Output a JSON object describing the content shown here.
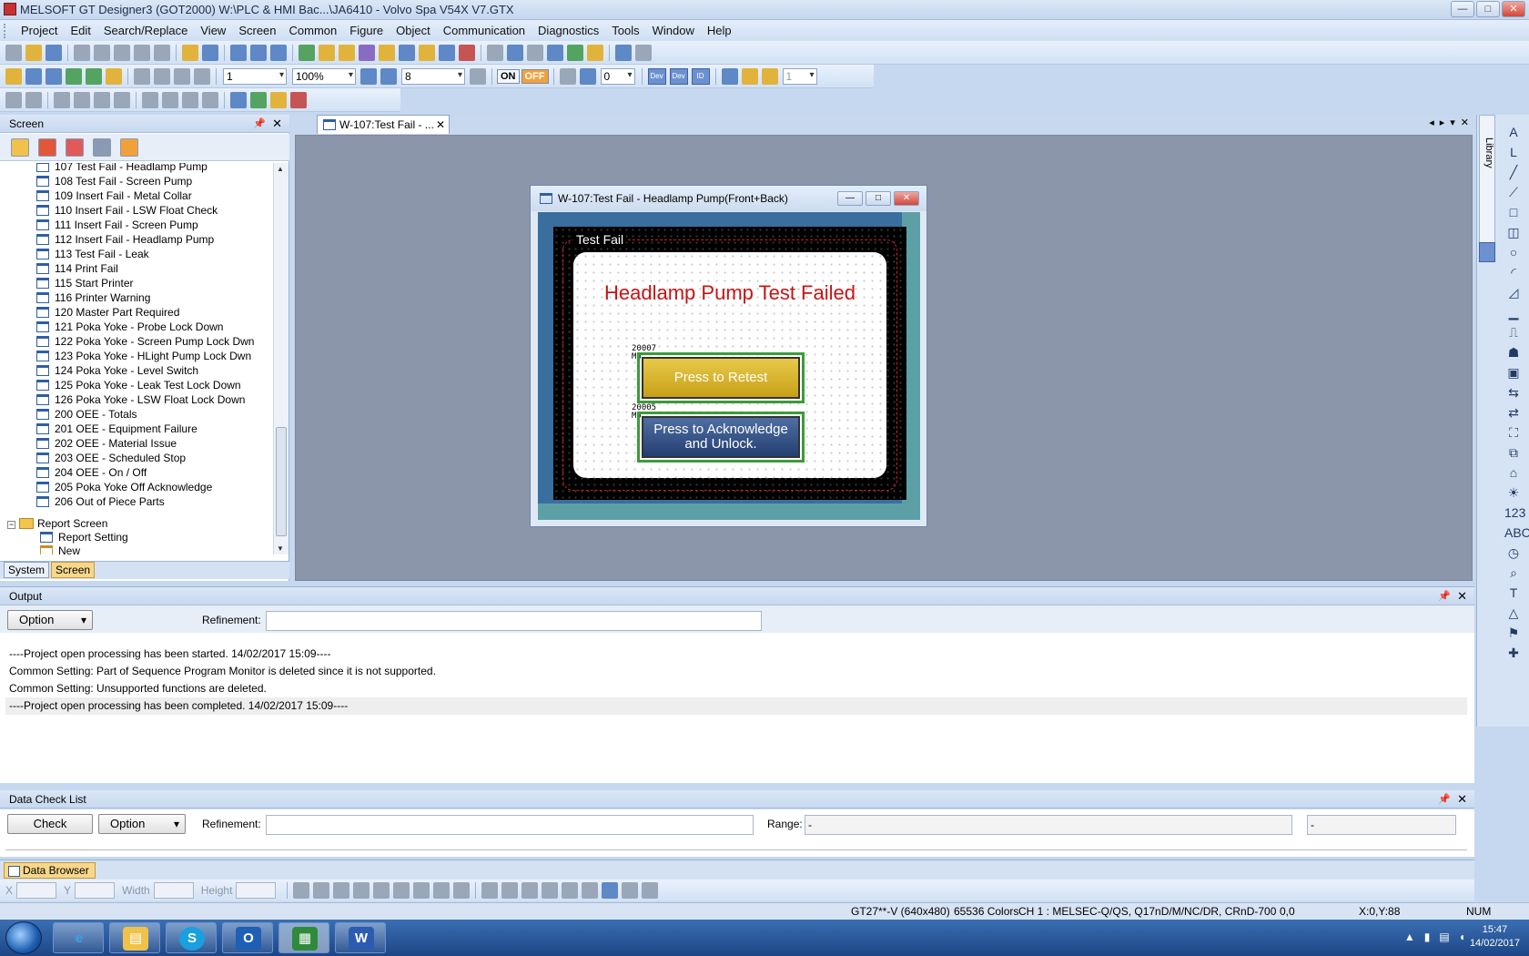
{
  "window": {
    "title": "MELSOFT GT Designer3 (GOT2000) W:\\PLC & HMI Bac...\\JA6410 - Volvo Spa V54X V7.GTX",
    "btn_minimize": "—",
    "btn_maximize": "□",
    "btn_close": "✕"
  },
  "menu": [
    "Project",
    "Edit",
    "Search/Replace",
    "View",
    "Screen",
    "Common",
    "Figure",
    "Object",
    "Communication",
    "Diagnostics",
    "Tools",
    "Window",
    "Help"
  ],
  "toolbar": {
    "screen_no": "1",
    "zoom": "100%",
    "grid": "8",
    "on_label": "ON",
    "off_label": "OFF",
    "nav_value": "0",
    "layer_value": "1",
    "dev_label": "Dev",
    "id_label": "ID"
  },
  "screen_panel": {
    "title": "Screen",
    "pin": "📌",
    "close": "✕",
    "items": [
      "107 Test Fail - Headlamp Pump",
      "108 Test Fail - Screen Pump",
      "109 Insert Fail - Metal Collar",
      "110 Insert Fail - LSW Float Check",
      "111 Insert Fail - Screen Pump",
      "112 Insert Fail - Headlamp Pump",
      "113 Test Fail - Leak",
      "114 Print Fail",
      "115 Start Printer",
      "116 Printer Warning",
      "120 Master Part Required",
      "121 Poka Yoke - Probe Lock Down",
      "122 Poka Yoke - Screen Pump Lock Dwn",
      "123 Poka Yoke - HLight Pump Lock Dwn",
      "124 Poka Yoke - Level Switch",
      "125 Poka Yoke - Leak Test Lock Down",
      "126 Poka Yoke - LSW Float Lock Down",
      "200 OEE - Totals",
      "201 OEE - Equipment Failure",
      "202 OEE - Material Issue",
      "203 OEE - Scheduled Stop",
      "204 OEE - On / Off",
      "205 Poka Yoke Off Acknowledge",
      "206 Out of Piece Parts"
    ],
    "folder": "Report Screen",
    "folder_items": [
      "Report Setting",
      "New"
    ],
    "tabs": [
      "System",
      "Screen"
    ]
  },
  "document": {
    "tab_label": "W-107:Test Fail - ...",
    "tab_close": "✕",
    "child_title": "W-107:Test Fail - Headlamp Pump(Front+Back)",
    "frame_label": "Test Fail",
    "heading": "Headlamp Pump Test Failed",
    "retest_device": "20007",
    "retest_sub": "M6",
    "retest_label": "Press to Retest",
    "ack_device": "20005",
    "ack_sub": "M5",
    "ack_label_1": "Press to Acknowledge",
    "ack_label_2": "and Unlock."
  },
  "library": {
    "tab": "Library"
  },
  "right_tools": [
    "A",
    "L",
    "╱",
    "⟋",
    "□",
    "◫",
    "○",
    "◜",
    "◿",
    "▁",
    "⎍",
    "☗",
    "▣",
    "⇆",
    "⇄",
    "⛶",
    "⧉",
    "⌂",
    "☀",
    "123",
    "ABC",
    "◷",
    "⌕",
    "T",
    "△",
    "⚑",
    "✚"
  ],
  "output": {
    "title": "Output",
    "option_label": "Option",
    "refinement_label": "Refinement:",
    "lines": [
      "----Project open processing has been started.  14/02/2017 15:09----",
      "Common Setting: Part of Sequence Program Monitor is deleted since it is not supported.",
      "Common Setting: Unsupported functions are deleted.",
      "----Project open processing has been completed.  14/02/2017 15:09----"
    ]
  },
  "data_check": {
    "title": "Data Check List",
    "check_label": "Check",
    "option_label": "Option",
    "refinement_label": "Refinement:",
    "range_label": "Range:",
    "range_from": "-",
    "range_to": "-"
  },
  "data_browser": {
    "tab": "Data Browser"
  },
  "props": {
    "x": "X",
    "y": "Y",
    "width": "Width",
    "height": "Height"
  },
  "status": {
    "device": "GT27**-V (640x480)",
    "colors": "65536 Colors",
    "channel": "CH 1 : MELSEC-Q/QS, Q17nD/M/NC/DR, CRnD-700",
    "size": "0,0",
    "pos": "X:0,Y:88",
    "num": "NUM"
  },
  "taskbar": {
    "apps": [
      "e",
      "▤",
      "S",
      "O",
      "▦",
      "W"
    ],
    "time": "15:47",
    "date": "14/02/2017"
  },
  "colors": {
    "heading_red": "#c81414",
    "retest_yellow": "#d9b42a",
    "ack_blue": "#2f4d84",
    "select_green": "#3b9c3b"
  }
}
